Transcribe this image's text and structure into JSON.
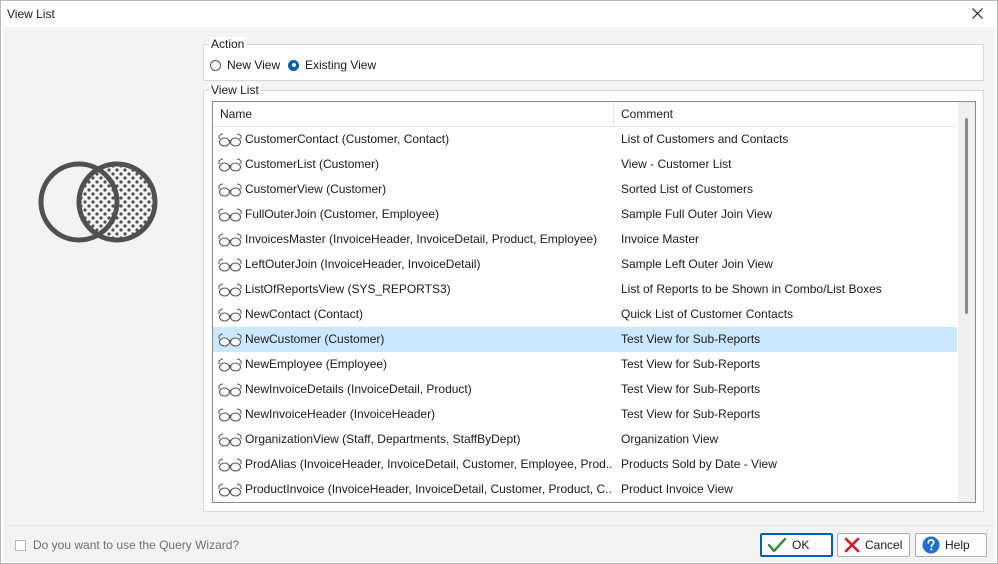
{
  "window": {
    "title": "View List"
  },
  "action": {
    "label": "Action",
    "options": [
      {
        "label": "New View",
        "checked": false
      },
      {
        "label": "Existing View",
        "checked": true
      }
    ]
  },
  "view_list": {
    "label": "View List",
    "columns": {
      "name": "Name",
      "comment": "Comment"
    },
    "selected_index": 8,
    "rows": [
      {
        "name": "CustomerContact (Customer, Contact)",
        "comment": "List of Customers and Contacts"
      },
      {
        "name": "CustomerList (Customer)",
        "comment": "View - Customer List"
      },
      {
        "name": "CustomerView (Customer)",
        "comment": "Sorted List of Customers"
      },
      {
        "name": "FullOuterJoin (Customer, Employee)",
        "comment": "Sample Full Outer Join View"
      },
      {
        "name": "InvoicesMaster (InvoiceHeader, InvoiceDetail, Product, Employee)",
        "comment": "Invoice Master"
      },
      {
        "name": "LeftOuterJoin (InvoiceHeader, InvoiceDetail)",
        "comment": "Sample Left Outer Join View"
      },
      {
        "name": "ListOfReportsView (SYS_REPORTS3)",
        "comment": "List of Reports to be Shown in Combo/List Boxes"
      },
      {
        "name": "NewContact (Contact)",
        "comment": "Quick List of Customer Contacts"
      },
      {
        "name": "NewCustomer (Customer)",
        "comment": "Test View for Sub-Reports"
      },
      {
        "name": "NewEmployee (Employee)",
        "comment": "Test View for Sub-Reports"
      },
      {
        "name": "NewInvoiceDetails (InvoiceDetail, Product)",
        "comment": "Test View for Sub-Reports"
      },
      {
        "name": "NewInvoiceHeader (InvoiceHeader)",
        "comment": "Test View for Sub-Reports"
      },
      {
        "name": "OrganizationView (Staff, Departments, StaffByDept)",
        "comment": "Organization View"
      },
      {
        "name": "ProdAlias (InvoiceHeader, InvoiceDetail, Customer, Employee, Prod...",
        "comment": "Products Sold by Date - View"
      },
      {
        "name": "ProductInvoice (InvoiceHeader, InvoiceDetail, Customer, Product, C...",
        "comment": "Product Invoice View"
      }
    ]
  },
  "footer": {
    "wizard_label": "Do you want to use the Query Wizard?",
    "ok_label": "OK",
    "cancel_label": "Cancel",
    "help_label": "Help"
  },
  "icons": {
    "row_icon": "glasses-icon",
    "view_icon": "venn-diagram-icon",
    "ok_icon": "checkmark-icon",
    "cancel_icon": "red-x-icon",
    "help_icon": "question-mark-icon"
  },
  "colors": {
    "selection": "#cce8ff",
    "accent": "#005fb8",
    "cancel_red": "#e81123",
    "ok_green": "#2e8b2e"
  }
}
